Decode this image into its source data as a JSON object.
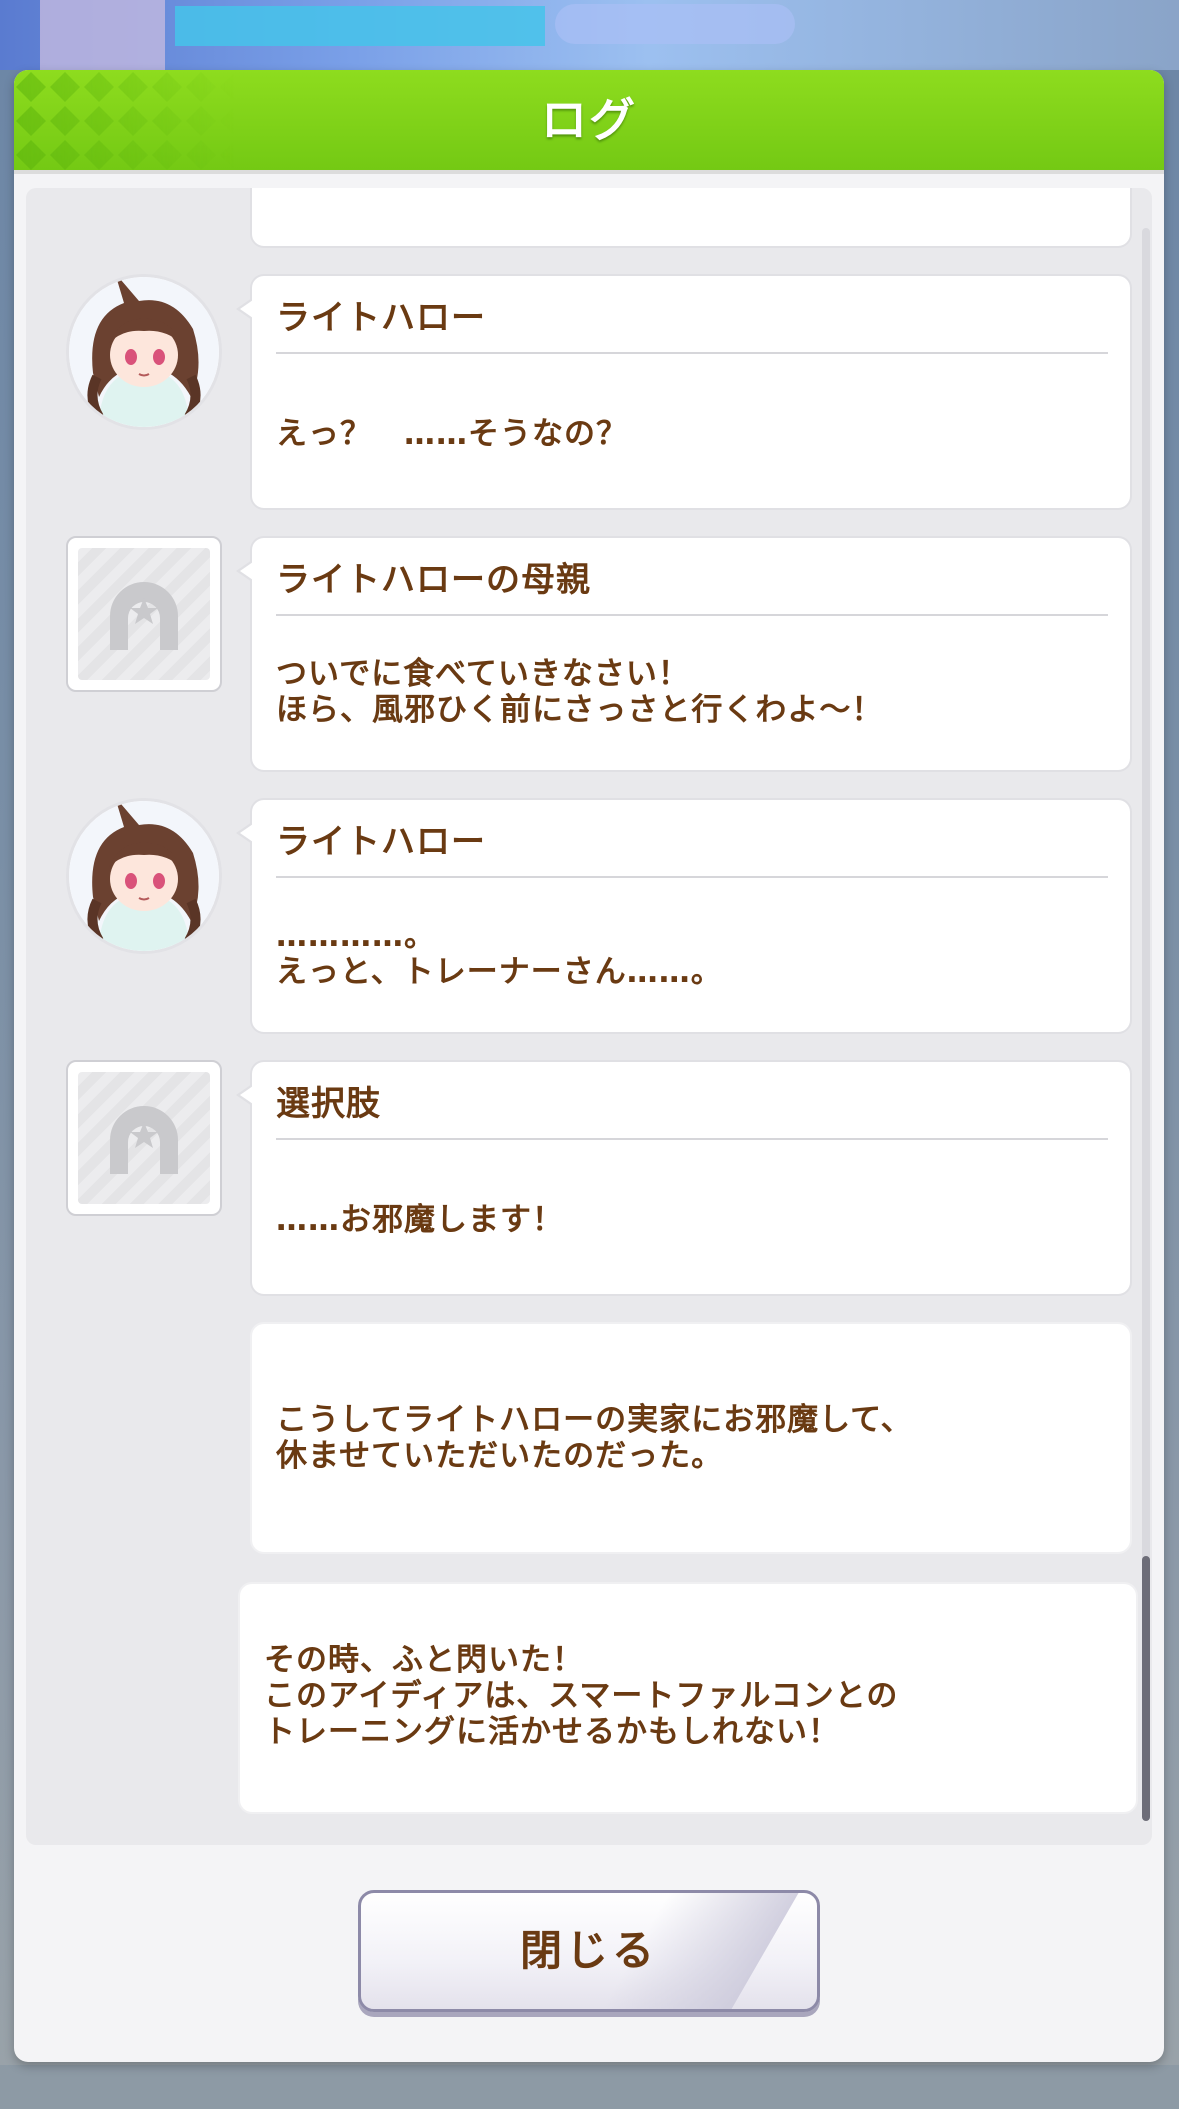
{
  "window": {
    "title": "ログ"
  },
  "entries": [
    {
      "type": "partial",
      "text": ""
    },
    {
      "type": "dialogue",
      "avatar": "character-portrait",
      "speaker": "ライトハロー",
      "text": "えっ？　……そうなの？"
    },
    {
      "type": "dialogue",
      "avatar": "horseshoe-placeholder-icon",
      "speaker": "ライトハローの母親",
      "text": "ついでに食べていきなさい！\nほら、風邪ひく前にさっさと行くわよ～！"
    },
    {
      "type": "dialogue",
      "avatar": "character-portrait",
      "speaker": "ライトハロー",
      "text": "…………。\nえっと、トレーナーさん……。"
    },
    {
      "type": "dialogue",
      "avatar": "horseshoe-placeholder-icon",
      "speaker": "選択肢",
      "text": "……お邪魔します！"
    },
    {
      "type": "narration",
      "text": "こうしてライトハローの実家にお邪魔して、\n休ませていただいたのだった。"
    },
    {
      "type": "narration",
      "text": "その時、ふと閃いた！\nこのアイディアは、スマートファルコンとの\nトレーニングに活かせるかもしれない！"
    }
  ],
  "footer": {
    "close_label": "閉じる"
  },
  "colors": {
    "header_green": "#7ed11a",
    "text_brown": "#6a3a12",
    "scrollbar_thumb": "#6d6d78"
  }
}
